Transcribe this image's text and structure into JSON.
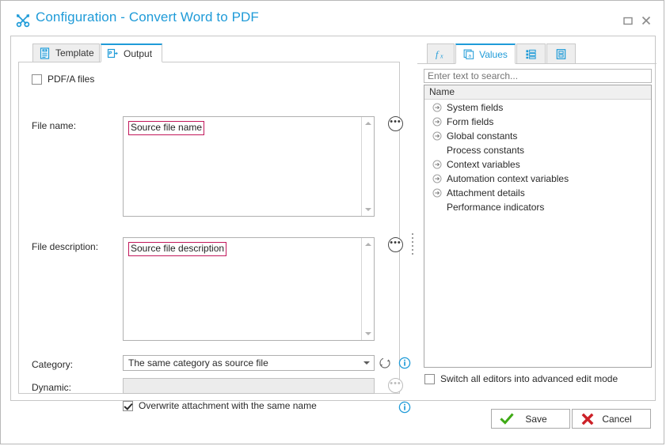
{
  "window": {
    "title": "Configuration - Convert Word to PDF",
    "title_icon": "tools-icon",
    "accent_color": "#1f9bd8",
    "controls": {
      "maximize": "maximize-icon",
      "close": "close-icon"
    }
  },
  "left_pane": {
    "tabs": [
      {
        "label": "Template",
        "icon": "word-document-icon",
        "active": false
      },
      {
        "label": "Output",
        "icon": "export-pdf-icon",
        "active": true
      }
    ],
    "pdfa_checkbox": {
      "label": "PDF/A files",
      "checked": false
    },
    "file_name": {
      "label": "File name:",
      "token": "Source file name",
      "ellipsis_label": "•••"
    },
    "file_description": {
      "label": "File description:",
      "token": "Source file description",
      "ellipsis_label": "•••"
    },
    "category": {
      "label": "Category:",
      "value": "The same category as source file",
      "refresh_icon": "refresh-icon",
      "info_icon": "info-icon"
    },
    "dynamic": {
      "label": "Dynamic:",
      "value": "",
      "placeholder": "",
      "disabled": true,
      "ellipsis_label": "•••"
    },
    "overwrite_checkbox": {
      "label": "Overwrite attachment with the same name",
      "checked": true,
      "info_icon": "info-icon"
    }
  },
  "right_pane": {
    "tabs": [
      {
        "label": "",
        "icon": "function-fx-icon",
        "active": false
      },
      {
        "label": "Values",
        "icon": "values-card-icon",
        "active": true
      },
      {
        "label": "",
        "icon": "list-properties-icon",
        "active": false
      },
      {
        "label": "",
        "icon": "document-fields-icon",
        "active": false
      }
    ],
    "search": {
      "value": "",
      "placeholder": "Enter text to search..."
    },
    "tree": {
      "column_header": "Name",
      "items": [
        {
          "label": "System fields",
          "expandable": true
        },
        {
          "label": "Form fields",
          "expandable": true
        },
        {
          "label": "Global constants",
          "expandable": true
        },
        {
          "label": "Process constants",
          "expandable": false
        },
        {
          "label": "Context variables",
          "expandable": true
        },
        {
          "label": "Automation context variables",
          "expandable": true
        },
        {
          "label": "Attachment details",
          "expandable": true
        },
        {
          "label": "Performance indicators",
          "expandable": false
        }
      ]
    },
    "switch_checkbox": {
      "label": "Switch all editors into advanced edit mode",
      "checked": false
    }
  },
  "footer": {
    "save_label": "Save",
    "save_icon": "green-check-icon",
    "cancel_label": "Cancel",
    "cancel_icon": "red-x-icon"
  }
}
